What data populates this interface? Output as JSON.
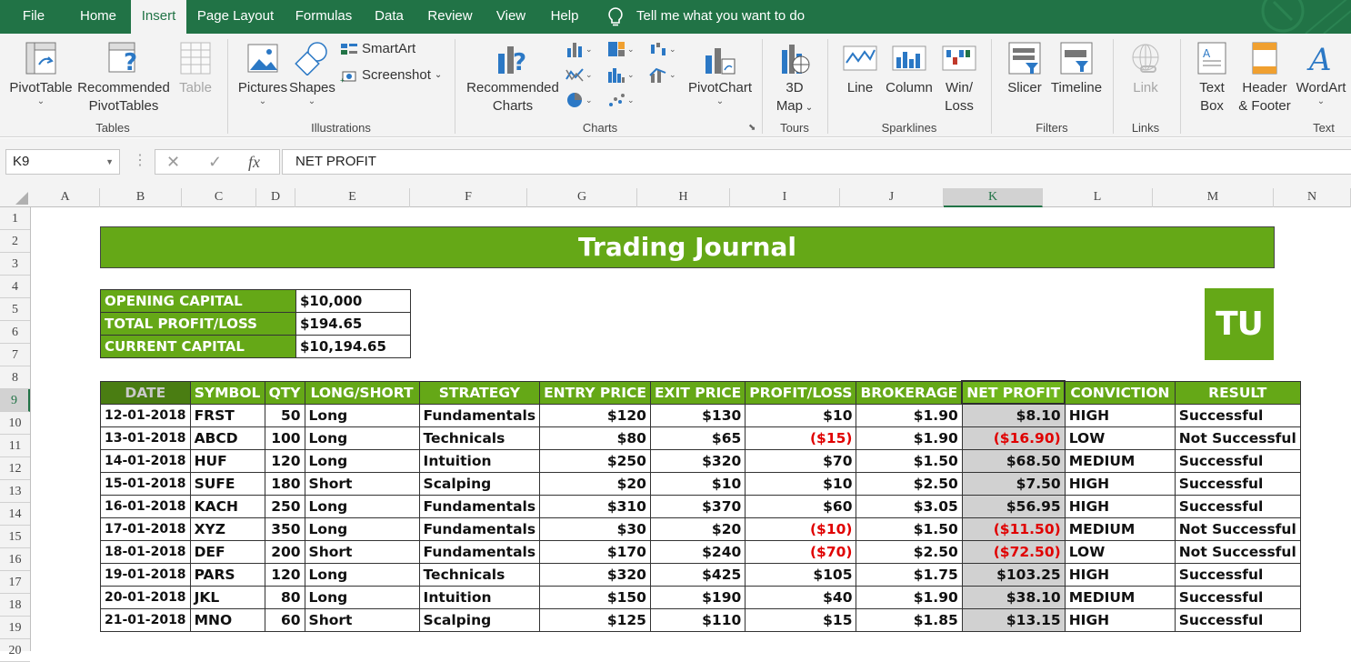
{
  "menu": {
    "tabs": [
      "File",
      "Home",
      "Insert",
      "Page Layout",
      "Formulas",
      "Data",
      "Review",
      "View",
      "Help"
    ],
    "active_tab": "Insert",
    "tell_me": "Tell me what you want to do"
  },
  "ribbon": {
    "tables": {
      "group_label": "Tables",
      "pivottable": "PivotTable",
      "recommended_pivottables_1": "Recommended",
      "recommended_pivottables_2": "PivotTables",
      "table": "Table"
    },
    "illustrations": {
      "group_label": "Illustrations",
      "pictures": "Pictures",
      "shapes": "Shapes",
      "smartart": "SmartArt",
      "screenshot": "Screenshot"
    },
    "charts": {
      "group_label": "Charts",
      "recommended_charts_1": "Recommended",
      "recommended_charts_2": "Charts",
      "pivotchart": "PivotChart"
    },
    "tours": {
      "group_label": "Tours",
      "map_1": "3D",
      "map_2": "Map"
    },
    "sparklines": {
      "group_label": "Sparklines",
      "line": "Line",
      "column": "Column",
      "winloss_1": "Win/",
      "winloss_2": "Loss"
    },
    "filters": {
      "group_label": "Filters",
      "slicer": "Slicer",
      "timeline": "Timeline"
    },
    "links": {
      "group_label": "Links",
      "link": "Link"
    },
    "text": {
      "group_label": "Text",
      "textbox_1": "Text",
      "textbox_2": "Box",
      "header_1": "Header",
      "header_2": "& Footer",
      "wordart": "WordArt"
    }
  },
  "formula_bar": {
    "name_box": "K9",
    "fx": "fx",
    "formula": "NET PROFIT"
  },
  "columns": [
    "A",
    "B",
    "C",
    "D",
    "E",
    "F",
    "G",
    "H",
    "I",
    "J",
    "K",
    "L",
    "M",
    "N"
  ],
  "selected_column": "K",
  "rows": [
    "1",
    "2",
    "3",
    "4",
    "5",
    "6",
    "7",
    "8",
    "9",
    "10",
    "11",
    "12",
    "13",
    "14",
    "15",
    "16",
    "17",
    "18",
    "19",
    "20"
  ],
  "selected_row": "9",
  "sheet": {
    "title": "Trading Journal",
    "logo": "TU",
    "summary": [
      {
        "label": "OPENING CAPITAL",
        "value": "$10,000"
      },
      {
        "label": "TOTAL PROFIT/LOSS",
        "value": "$194.65"
      },
      {
        "label": "CURRENT CAPITAL",
        "value": "$10,194.65"
      }
    ],
    "headers": [
      "DATE",
      "SYMBOL",
      "QTY",
      "LONG/SHORT",
      "STRATEGY",
      "ENTRY PRICE",
      "EXIT PRICE",
      "PROFIT/LOSS",
      "BROKERAGE",
      "NET PROFIT",
      "CONVICTION",
      "RESULT"
    ],
    "trades": [
      [
        "12-01-2018",
        "FRST",
        "50",
        "Long",
        "Fundamentals",
        "$120",
        "$130",
        "$10",
        "$1.90",
        "$8.10",
        "HIGH",
        "Successful"
      ],
      [
        "13-01-2018",
        "ABCD",
        "100",
        "Long",
        "Technicals",
        "$80",
        "$65",
        "($15)",
        "$1.90",
        "($16.90)",
        "LOW",
        "Not Successful"
      ],
      [
        "14-01-2018",
        "HUF",
        "120",
        "Long",
        "Intuition",
        "$250",
        "$320",
        "$70",
        "$1.50",
        "$68.50",
        "MEDIUM",
        "Successful"
      ],
      [
        "15-01-2018",
        "SUFE",
        "180",
        "Short",
        "Scalping",
        "$20",
        "$10",
        "$10",
        "$2.50",
        "$7.50",
        "HIGH",
        "Successful"
      ],
      [
        "16-01-2018",
        "KACH",
        "250",
        "Long",
        "Fundamentals",
        "$310",
        "$370",
        "$60",
        "$3.05",
        "$56.95",
        "HIGH",
        "Successful"
      ],
      [
        "17-01-2018",
        "XYZ",
        "350",
        "Long",
        "Fundamentals",
        "$30",
        "$20",
        "($10)",
        "$1.50",
        "($11.50)",
        "MEDIUM",
        "Not Successful"
      ],
      [
        "18-01-2018",
        "DEF",
        "200",
        "Short",
        "Fundamentals",
        "$170",
        "$240",
        "($70)",
        "$2.50",
        "($72.50)",
        "LOW",
        "Not Successful"
      ],
      [
        "19-01-2018",
        "PARS",
        "120",
        "Long",
        "Technicals",
        "$320",
        "$425",
        "$105",
        "$1.75",
        "$103.25",
        "HIGH",
        "Successful"
      ],
      [
        "20-01-2018",
        "JKL",
        "80",
        "Long",
        "Intuition",
        "$150",
        "$190",
        "$40",
        "$1.90",
        "$38.10",
        "MEDIUM",
        "Successful"
      ],
      [
        "21-01-2018",
        "MNO",
        "60",
        "Short",
        "Scalping",
        "$125",
        "$110",
        "$15",
        "$1.85",
        "$13.15",
        "HIGH",
        "Successful"
      ]
    ]
  },
  "colors": {
    "excel_green": "#217346",
    "table_green": "#65a817",
    "negative_red": "#e00000"
  }
}
